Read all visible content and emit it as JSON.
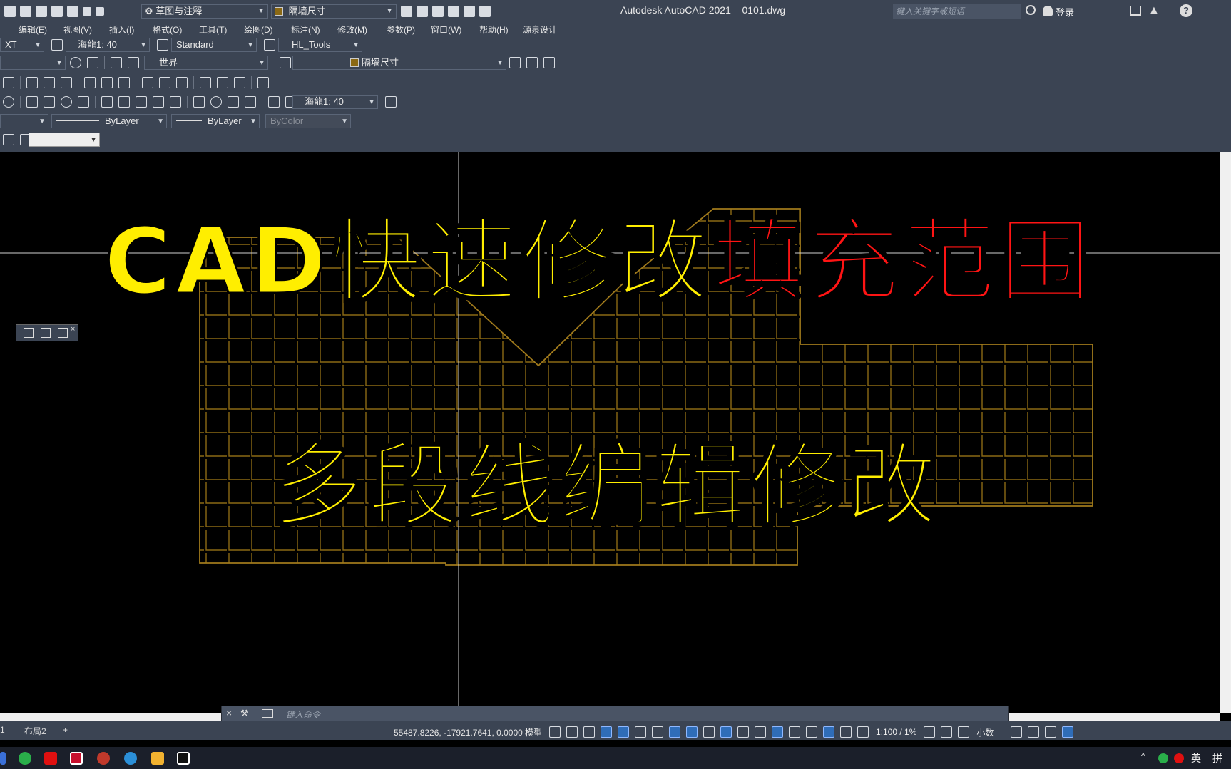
{
  "window": {
    "title": "Autodesk AutoCAD 2021    0101.dwg",
    "workspace": "草图与注释",
    "layer_top": "隔墙尺寸",
    "search_placeholder": "键入关键字或短语",
    "login": "登录"
  },
  "menu": [
    "编辑(E)",
    "视图(V)",
    "插入(I)",
    "格式(O)",
    "工具(T)",
    "绘图(D)",
    "标注(N)",
    "修改(M)",
    "参数(P)",
    "窗口(W)",
    "帮助(H)",
    "源泉设计"
  ],
  "toolbar": {
    "text_style_partial": "XT",
    "annotation_scale": "海龍1: 40",
    "dim_style": "Standard",
    "table_style": "HL_Tools",
    "ucs": "世界",
    "layer": "隔墙尺寸",
    "dim_scale": "海龍1: 40",
    "linetype": "ByLayer",
    "lineweight": "ByLayer",
    "plot_color": "ByColor"
  },
  "overlay": {
    "line1_yellow": "CAD快速修改",
    "line1_red": "填充范围",
    "line2": "多段线编辑修改"
  },
  "command": {
    "placeholder": "键入命令"
  },
  "layouts": [
    "1",
    "布局2",
    "+"
  ],
  "status": {
    "coordinates": "55487.8226, -17921.7641, 0.0000",
    "mode": "模型",
    "scale": "1:100 / 1%",
    "units": "小数"
  },
  "tray": {
    "ime": "英",
    "extra": "拼"
  },
  "colors": {
    "chrome": "#3b4453",
    "hatch": "#8b6914",
    "yellow": "#ffee00",
    "red": "#ff1414"
  }
}
